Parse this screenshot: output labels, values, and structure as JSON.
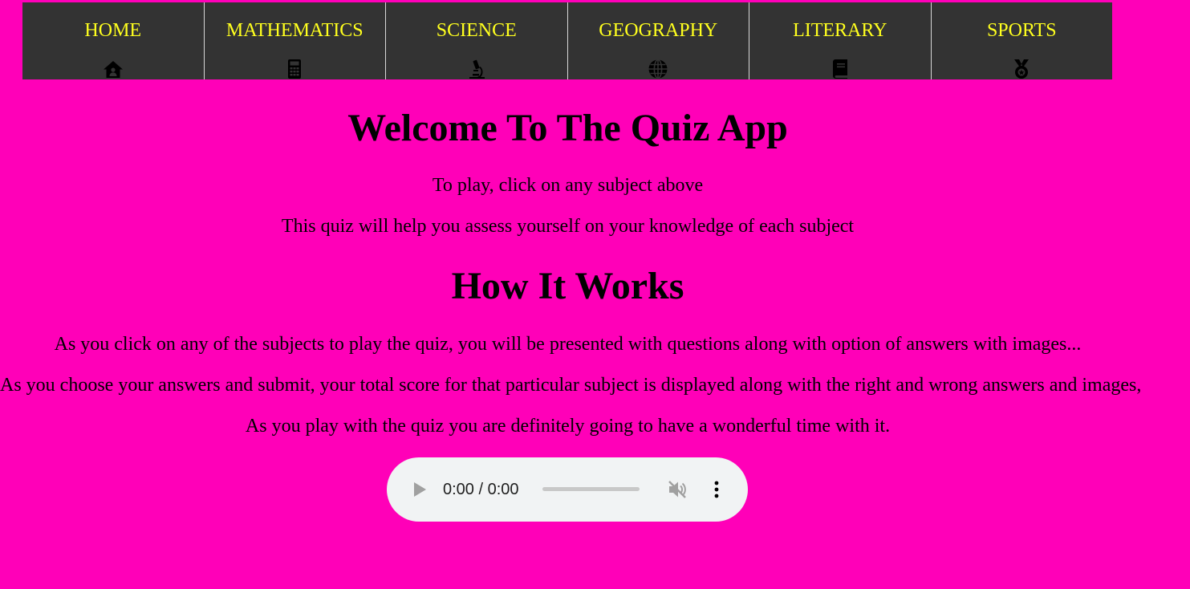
{
  "nav": {
    "items": [
      {
        "label": "HOME",
        "icon": "home-icon"
      },
      {
        "label": "MATHEMATICS",
        "icon": "calculator-icon"
      },
      {
        "label": "SCIENCE",
        "icon": "microscope-icon"
      },
      {
        "label": "GEOGRAPHY",
        "icon": "globe-icon"
      },
      {
        "label": "LITERARY",
        "icon": "book-icon"
      },
      {
        "label": "SPORTS",
        "icon": "medal-icon"
      }
    ]
  },
  "main": {
    "title": "Welcome To The Quiz App",
    "intro": [
      "To play, click on any subject above",
      "This quiz will help you assess yourself on your knowledge of each subject"
    ],
    "how_title": "How It Works",
    "how": [
      "As you click on any of the subjects to play the quiz, you will be presented with questions along with option of answers with images...",
      "As you choose your answers and submit, your total score for that particular subject is displayed along with the right and wrong answers and images,",
      "As you play with the quiz you are definitely going to have a wonderful time with it."
    ]
  },
  "audio": {
    "time": "0:00 / 0:00",
    "progress": 0,
    "muted": true
  },
  "colors": {
    "background": "#ff00b8",
    "nav_background": "#333333",
    "nav_text": "#ffff1e"
  }
}
